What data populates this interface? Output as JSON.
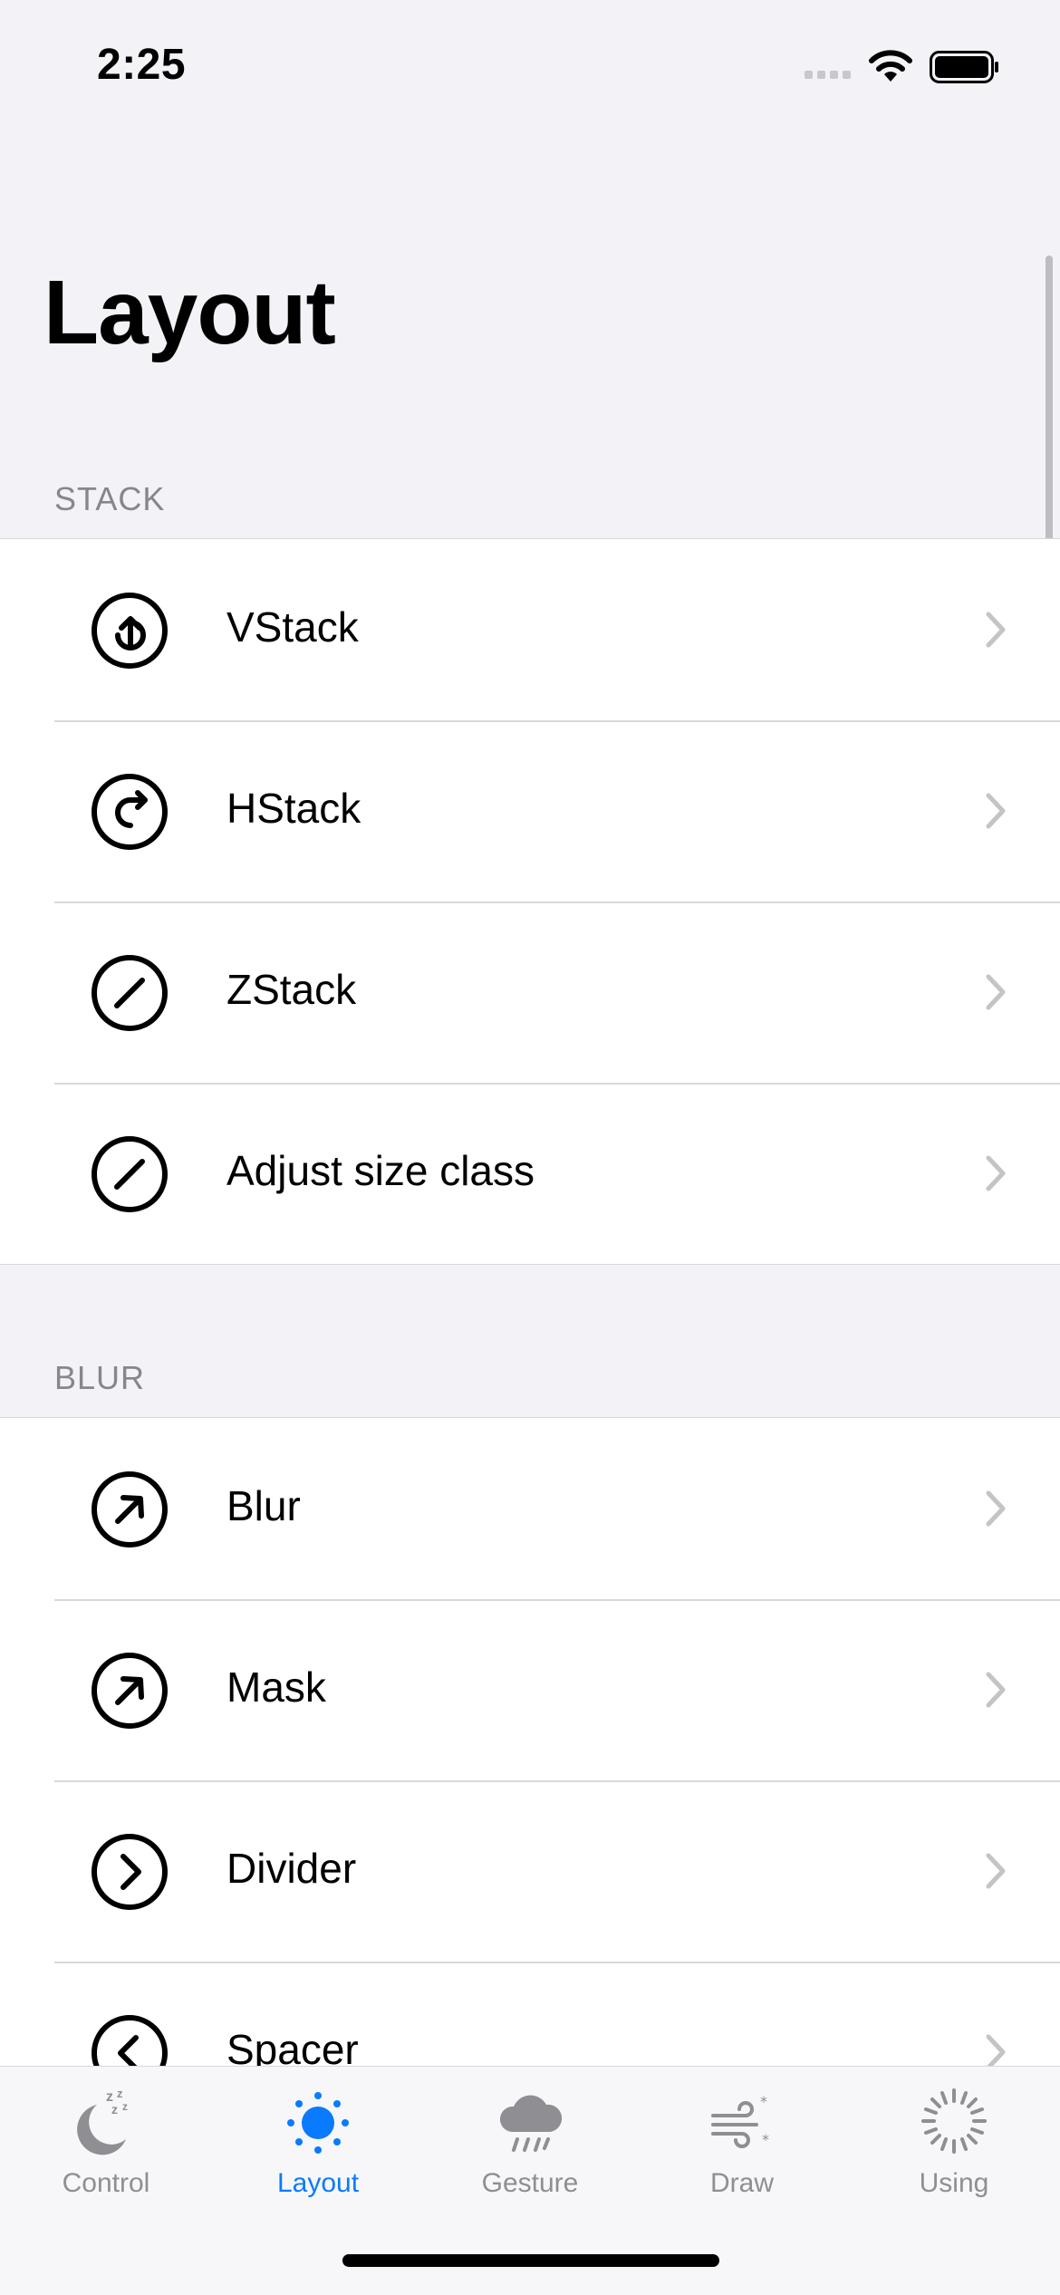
{
  "status": {
    "time": "2:25"
  },
  "title": "Layout",
  "sections": [
    {
      "header": "STACK",
      "items": [
        {
          "label": "VStack",
          "icon": "arrow-up-circle-icon"
        },
        {
          "label": "HStack",
          "icon": "arrow-right-circle-icon"
        },
        {
          "label": "ZStack",
          "icon": "slash-circle-icon"
        },
        {
          "label": "Adjust size class",
          "icon": "slash-circle-icon"
        }
      ]
    },
    {
      "header": "BLUR",
      "items": [
        {
          "label": "Blur",
          "icon": "arrow-up-right-circle-icon"
        },
        {
          "label": "Mask",
          "icon": "arrow-up-right-circle-icon"
        },
        {
          "label": "Divider",
          "icon": "chevron-right-circle-icon"
        },
        {
          "label": "Spacer",
          "icon": "chevron-left-circle-icon"
        }
      ]
    }
  ],
  "tabs": [
    {
      "label": "Control",
      "icon": "moon-zzz-icon",
      "active": false
    },
    {
      "label": "Layout",
      "icon": "sun-icon",
      "active": true
    },
    {
      "label": "Gesture",
      "icon": "cloud-rain-icon",
      "active": false
    },
    {
      "label": "Draw",
      "icon": "wind-snow-icon",
      "active": false
    },
    {
      "label": "Using",
      "icon": "loading-spinner-icon",
      "active": false
    }
  ],
  "colors": {
    "accent": "#0a7aff",
    "inactive": "#8e8e93",
    "background": "#f2f2f7"
  }
}
